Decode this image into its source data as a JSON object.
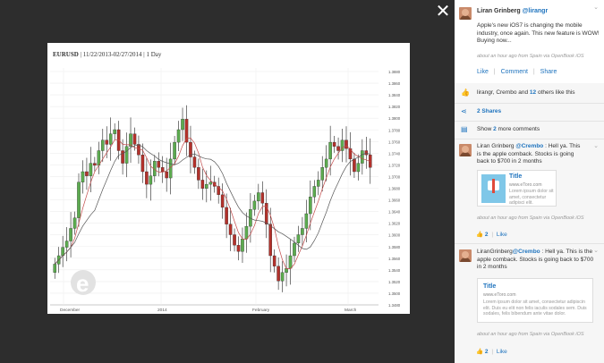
{
  "viewer": {
    "close_label": "✕"
  },
  "chart": {
    "symbol": "EURUSD",
    "range": "| 11/22/2013-02/27/2014 |",
    "interval": "1 Day",
    "y_ticks": [
      "1.3880",
      "1.3860",
      "1.3840",
      "1.3820",
      "1.3800",
      "1.3780",
      "1.3760",
      "1.3740",
      "1.3720",
      "1.3700",
      "1.3680",
      "1.3660",
      "1.3640",
      "1.3620",
      "1.3600",
      "1.3580",
      "1.3560",
      "1.3540",
      "1.3520",
      "1.3500",
      "1.3480"
    ],
    "x_ticks": [
      "December",
      "2014",
      "February",
      "March"
    ],
    "colors": {
      "up": "#5cab4f",
      "down": "#b3312b",
      "ma_red": "#c24a4a",
      "ma_gray": "#555555",
      "grid": "#eeeeee"
    }
  },
  "post": {
    "author": "Liran Grinberg",
    "handle": "@lirangr",
    "text": "Apple's new iOS7 is changing the mobile industry, once again. This new feature is WOW! Buying now...",
    "meta": "about an hour ago from Spain via OpenBook iOS",
    "actions": {
      "like": "Like",
      "comment": "Comment",
      "share": "Share"
    }
  },
  "likes": {
    "prefix": "lirangr, Crembo and",
    "count": "12",
    "suffix": "others like this"
  },
  "shares": {
    "label": "2 Shares"
  },
  "more_comments": {
    "prefix": "Show",
    "count": "2",
    "suffix": "more comments"
  },
  "comments": [
    {
      "author": "Liran Grinberg",
      "handle": "@Crembo",
      "text": ": Hell ya. This is the apple comback. Stocks is going back to $700 in 2 months",
      "card": {
        "title": "Title",
        "url": "www.eToro.com",
        "desc": "Lorem ipsum dolor sit amet, consectetur adipisci elit."
      },
      "meta": "about an hour ago from Spain via OpenBook iOS",
      "likes": "2",
      "like_label": "Like"
    },
    {
      "author": "LiranGrinberg",
      "handle": "@Crembo",
      "text": ": Hell ya. This is the apple comback. Stocks is going back to $700 in 2 months",
      "card": {
        "title": "Title",
        "url": "www.eToro.com",
        "desc": "Lorem ipsum dolor sit amet, consectetur adipiscin elit. Duis eu elit non felis iaculis sodales sem. Duis sodales, felis bibendum ante vitae dolor."
      },
      "meta": "about an hour ago from Spain via OpenBook iOS",
      "likes": "2",
      "like_label": "Like"
    }
  ]
}
